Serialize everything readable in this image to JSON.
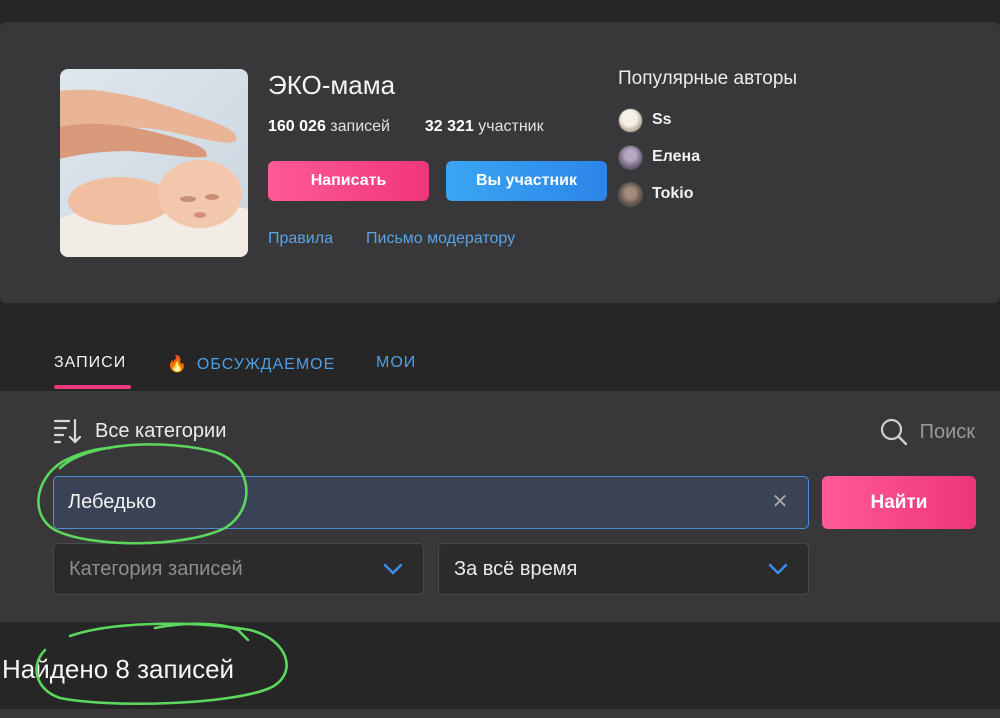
{
  "community": {
    "title": "ЭКО-мама",
    "posts_count": "160 026",
    "posts_word": "записей",
    "members_count": "32 321",
    "members_word": "участник",
    "write_button": "Написать",
    "member_button": "Вы участник",
    "rules_link": "Правила",
    "moderator_link": "Письмо модератору",
    "cover_image": "baby-with-hands-photo"
  },
  "popular_authors": {
    "title": "Популярные авторы",
    "authors": [
      {
        "name": "Ss",
        "avatar_color": "#d9d2c6"
      },
      {
        "name": "Елена",
        "avatar_color": "#8a7a96"
      },
      {
        "name": "Tokio",
        "avatar_color": "#6b5a52"
      }
    ]
  },
  "tabs": [
    {
      "label": "ЗАПИСИ",
      "active": true
    },
    {
      "label": "ОБСУЖДАЕМОЕ",
      "icon": "fire-icon",
      "active": false
    },
    {
      "label": "МОИ",
      "active": false
    }
  ],
  "filters": {
    "categories_label": "Все категории",
    "search_label": "Поиск",
    "search_value": "Лебедько",
    "find_button": "Найти",
    "category_select": "Категория записей",
    "time_select": "За всё время"
  },
  "results": {
    "found_text": "Найдено 8 записей"
  },
  "colors": {
    "accent_pink": "#f0397c",
    "accent_blue": "#2c85ea",
    "link_blue": "#5aa3e6",
    "annotation_green": "#5cd65c"
  }
}
